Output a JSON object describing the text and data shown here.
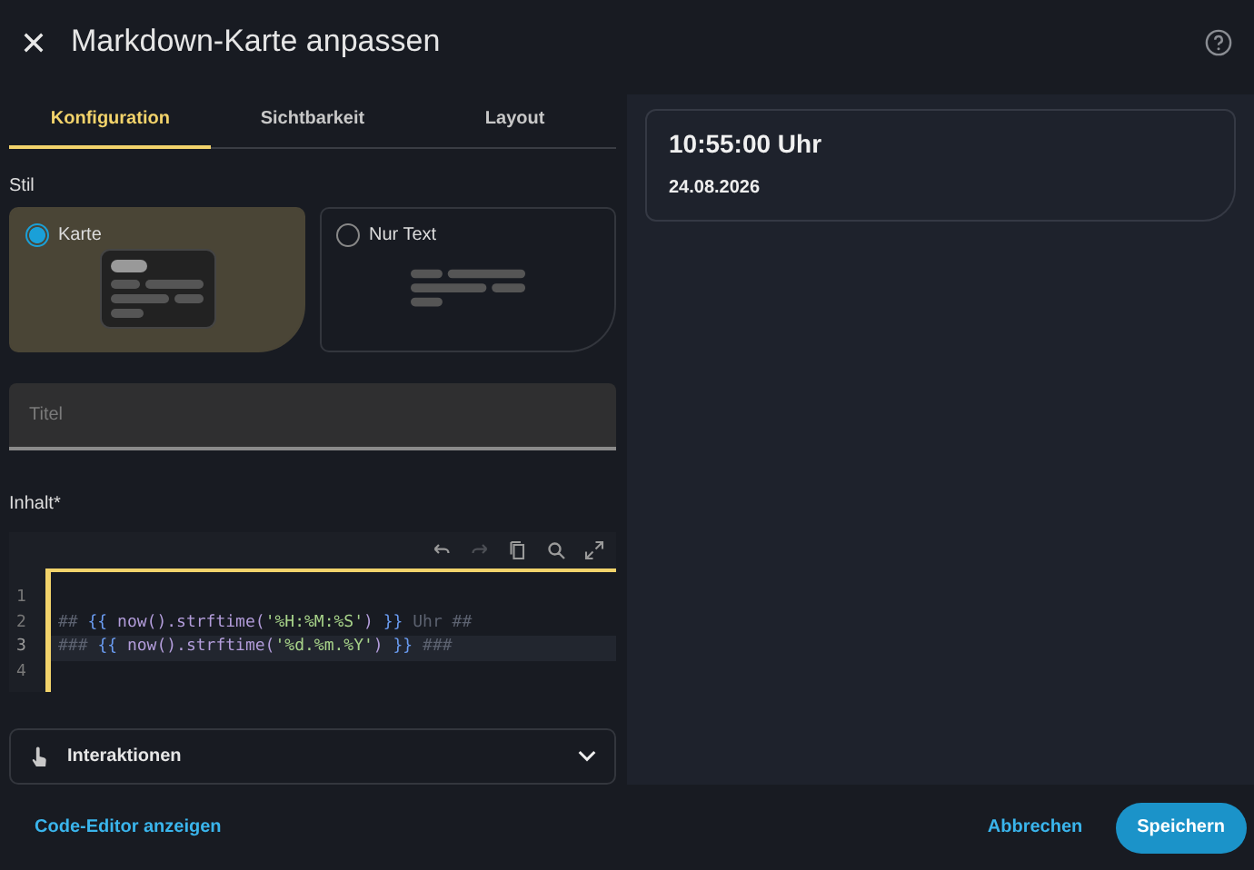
{
  "dialog": {
    "title": "Markdown-Karte anpassen"
  },
  "tabs": [
    {
      "label": "Konfiguration",
      "selected": true
    },
    {
      "label": "Sichtbarkeit",
      "selected": false
    },
    {
      "label": "Layout",
      "selected": false
    }
  ],
  "style": {
    "label": "Stil",
    "options": [
      {
        "label": "Karte",
        "kind": "card",
        "selected": true
      },
      {
        "label": "Nur Text",
        "kind": "text",
        "selected": false
      }
    ]
  },
  "title_field": {
    "placeholder": "Titel"
  },
  "content": {
    "label": "Inhalt*",
    "toolbar": [
      {
        "kind": "undo",
        "disabled": false
      },
      {
        "kind": "redo",
        "disabled": true
      },
      {
        "kind": "copy",
        "disabled": false
      },
      {
        "kind": "search",
        "disabled": false
      },
      {
        "kind": "expand",
        "disabled": false
      }
    ],
    "lines": [
      {
        "number": "1",
        "active": false
      },
      {
        "number": "2",
        "active": false,
        "tokens": [
          {
            "kind": "comment",
            "text": "## "
          },
          {
            "kind": "brace",
            "text": "{{"
          },
          {
            "kind": "func",
            "text": " now().strftime("
          },
          {
            "kind": "string",
            "text": "'%H:%M:%S'"
          },
          {
            "kind": "func",
            "text": ") "
          },
          {
            "kind": "brace",
            "text": "}}"
          },
          {
            "kind": "comment",
            "text": " Uhr ##"
          }
        ]
      },
      {
        "number": "3",
        "active": true,
        "tokens": [
          {
            "kind": "comment",
            "text": "### "
          },
          {
            "kind": "brace",
            "text": "{{"
          },
          {
            "kind": "func",
            "text": " now().strftime("
          },
          {
            "kind": "string",
            "text": "'%d.%m.%Y'"
          },
          {
            "kind": "func",
            "text": ") "
          },
          {
            "kind": "brace",
            "text": "}}"
          },
          {
            "kind": "comment",
            "text": " ###"
          }
        ]
      },
      {
        "number": "4",
        "active": false
      }
    ]
  },
  "interactions": {
    "label": "Interaktionen",
    "expanded": false
  },
  "preview": {
    "heading": "10:55:00 Uhr",
    "subheading": "24.08.2026"
  },
  "footer": {
    "code_editor_link": "Code-Editor anzeigen",
    "cancel": "Abbrechen",
    "save": "Speichern"
  }
}
